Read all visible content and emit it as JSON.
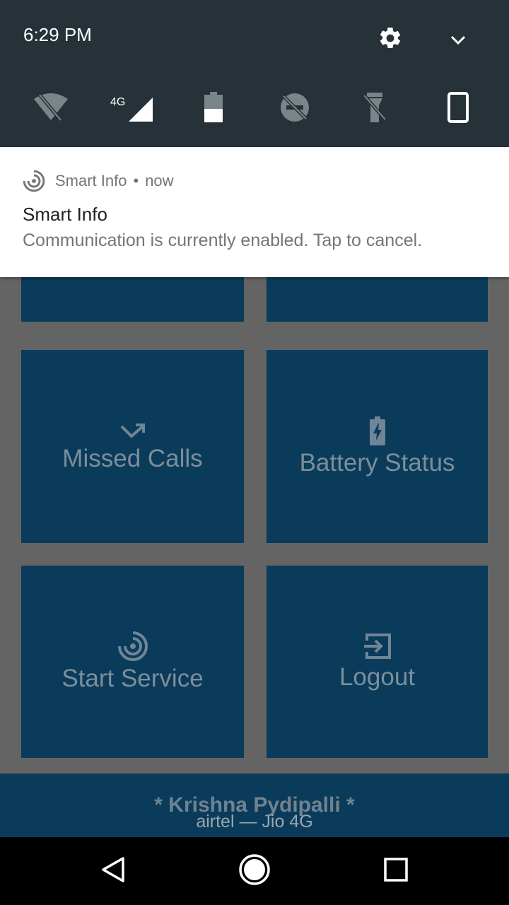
{
  "status": {
    "time": "6:29 PM",
    "network_label": "4G"
  },
  "quick_settings": [
    {
      "name": "wifi-off-icon"
    },
    {
      "name": "cellular-4g-icon"
    },
    {
      "name": "battery-icon"
    },
    {
      "name": "do-not-disturb-off-icon"
    },
    {
      "name": "flashlight-off-icon"
    },
    {
      "name": "rotation-portrait-icon"
    }
  ],
  "notification": {
    "app_name": "Smart Info",
    "separator": "•",
    "time": "now",
    "title": "Smart Info",
    "text": "Communication is currently enabled. Tap to cancel."
  },
  "tiles": [
    {
      "label": "Missed Calls",
      "icon": "missed-call-icon"
    },
    {
      "label": "Battery Status",
      "icon": "battery-charging-icon"
    },
    {
      "label": "Start Service",
      "icon": "radar-icon"
    },
    {
      "label": "Logout",
      "icon": "logout-icon"
    }
  ],
  "footer": {
    "name": "* Krishna Pydipalli *",
    "carrier": "airtel — Jio 4G"
  },
  "colors": {
    "shade_header": "#263238",
    "tile": "#0b3b5a",
    "scrim": "#646464"
  }
}
